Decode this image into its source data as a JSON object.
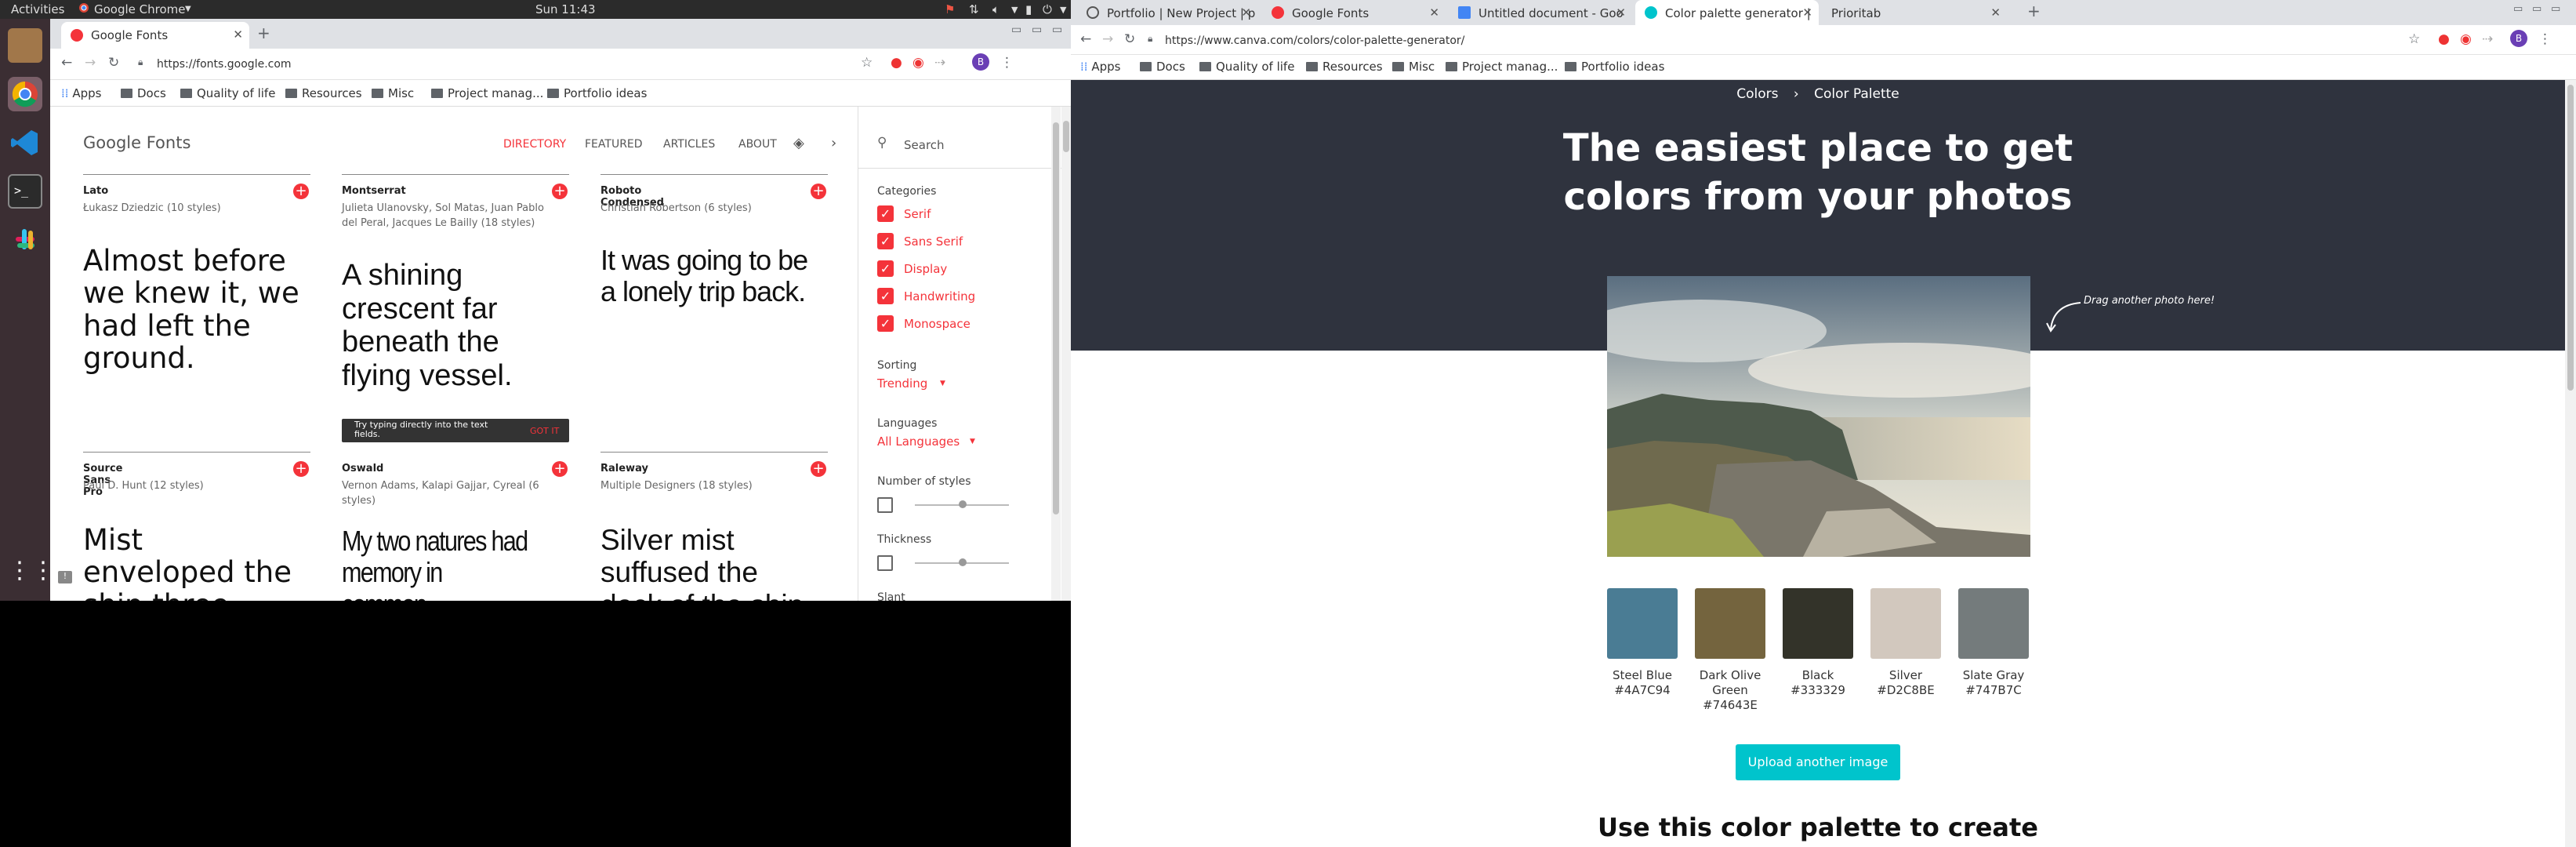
{
  "system": {
    "activities": "Activities",
    "app_menu": "Google Chrome",
    "clock": "Sun 11:43"
  },
  "fonts_window": {
    "tab": {
      "title": "Google Fonts"
    },
    "url": "https://fonts.google.com",
    "bookmarks": [
      "Apps",
      "Docs",
      "Quality of life",
      "Resources",
      "Misc",
      "Project manag...",
      "Portfolio ideas"
    ],
    "header": {
      "logo": "Google Fonts",
      "nav": [
        "DIRECTORY",
        "FEATURED",
        "ARTICLES",
        "ABOUT"
      ]
    },
    "cards": [
      {
        "name": "Lato",
        "designer": "Łukasz Dziedzic (10 styles)",
        "sample": "Almost before we knew it, we had left the ground."
      },
      {
        "name": "Montserrat",
        "designer": "Julieta Ulanovsky, Sol Matas, Juan Pablo del Peral, Jacques Le Bailly (18 styles)",
        "sample": "A shining crescent far beneath the flying vessel."
      },
      {
        "name": "Roboto Condensed",
        "designer": "Christian Robertson (6 styles)",
        "sample": "It was going to be a lonely trip back."
      },
      {
        "name": "Source Sans Pro",
        "designer": "Paul D. Hunt (12 styles)",
        "sample": "Mist enveloped the ship three hours out from port."
      },
      {
        "name": "Oswald",
        "designer": "Vernon Adams, Kalapi Gajjar, Cyreal (6 styles)",
        "sample": "My two natures had memory in common."
      },
      {
        "name": "Raleway",
        "designer": "Multiple Designers (18 styles)",
        "sample": "Silver mist suffused the deck of the ship."
      }
    ],
    "tooltip": {
      "text": "Try typing directly into the text fields.",
      "action": "GOT IT"
    },
    "sidebar": {
      "search_placeholder": "Search",
      "categories_label": "Categories",
      "categories": [
        "Serif",
        "Sans Serif",
        "Display",
        "Handwriting",
        "Monospace"
      ],
      "sorting_label": "Sorting",
      "sorting_value": "Trending",
      "languages_label": "Languages",
      "languages_value": "All Languages",
      "styles_label": "Number of styles",
      "thickness_label": "Thickness",
      "slant_label": "Slant"
    }
  },
  "canva_window": {
    "tabs": [
      "Portfolio | New Project | p",
      "Google Fonts",
      "Untitled document - Goo",
      "Color palette generator |",
      "Prioritab"
    ],
    "url": "https://www.canva.com/colors/color-palette-generator/",
    "bookmarks": [
      "Apps",
      "Docs",
      "Quality of life",
      "Resources",
      "Misc",
      "Project manag...",
      "Portfolio ideas"
    ],
    "breadcrumb": [
      "Colors",
      "Color Palette"
    ],
    "hero_title_line1": "The easiest place to get",
    "hero_title_line2": "colors from your photos",
    "drag_hint": "Drag another photo here!",
    "palette": [
      {
        "name": "Steel Blue",
        "hex": "#4A7C94"
      },
      {
        "name": "Dark Olive Green",
        "hex": "#74643E"
      },
      {
        "name": "Black",
        "hex": "#333329"
      },
      {
        "name": "Silver",
        "hex": "#D2C8BE"
      },
      {
        "name": "Slate Gray",
        "hex": "#747B7C"
      }
    ],
    "palette_display": [
      {
        "l1": "Steel Blue",
        "l2": "#4A7C94",
        "l3": ""
      },
      {
        "l1": "Dark Olive",
        "l2": "Green",
        "l3": "#74643E"
      },
      {
        "l1": "Black",
        "l2": "#333329",
        "l3": ""
      },
      {
        "l1": "Silver",
        "l2": "#D2C8BE",
        "l3": ""
      },
      {
        "l1": "Slate Gray",
        "l2": "#747B7C",
        "l3": ""
      }
    ],
    "upload_button": "Upload another image",
    "section_title": "Use this color palette to create"
  },
  "colors": {
    "accent_red": "#f4333a",
    "canva_dark": "#2f333e",
    "canva_teal": "#00c4cc"
  }
}
